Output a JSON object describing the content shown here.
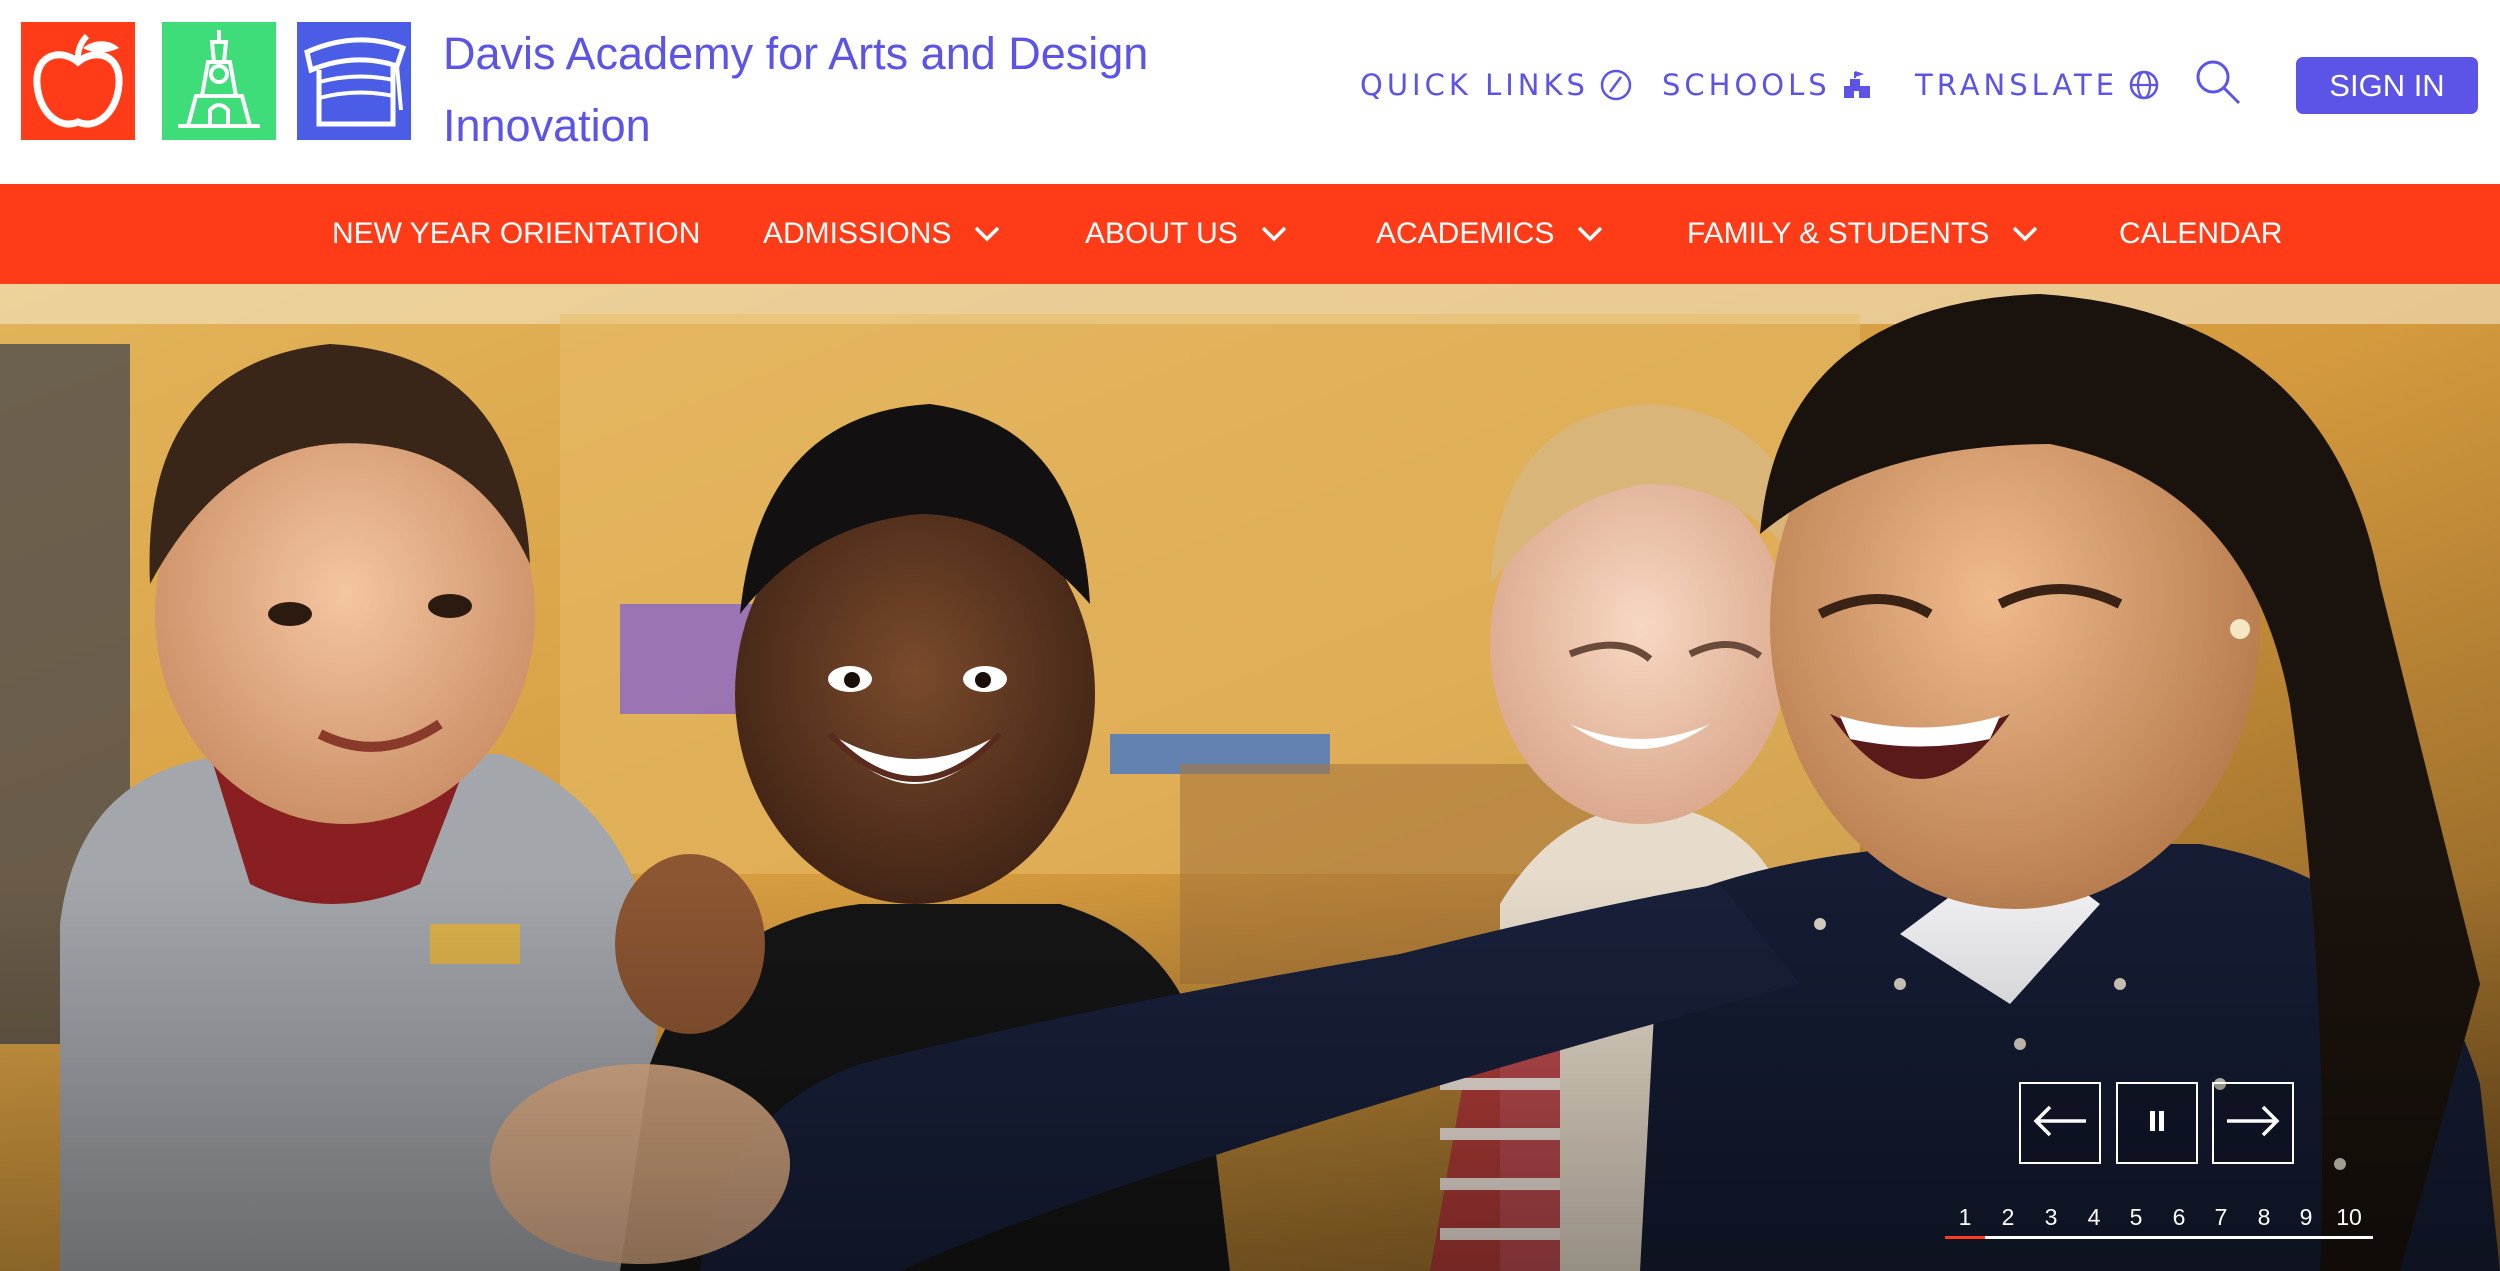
{
  "header": {
    "title": "Davis Academy for Arts and Design Innovation",
    "title_line1": "Davis Academy for Arts and Design",
    "title_line2": "Innovation",
    "logos": [
      {
        "name": "apple-logo",
        "color": "#ff3c17"
      },
      {
        "name": "tower-logo",
        "color": "#3fdc7a"
      },
      {
        "name": "cap-logo",
        "color": "#4b5ce6"
      }
    ],
    "utility": {
      "quick_links": "QUICK LINKS",
      "schools": "SCHOOLS",
      "translate": "TRANSLATE",
      "search_icon": "search-icon",
      "sign_in": "SIGN IN"
    }
  },
  "nav": {
    "items": [
      {
        "label": "NEW YEAR ORIENTATION",
        "dropdown": false
      },
      {
        "label": "ADMISSIONS",
        "dropdown": true
      },
      {
        "label": "ABOUT US",
        "dropdown": true
      },
      {
        "label": "ACADEMICS",
        "dropdown": true
      },
      {
        "label": "FAMILY & STUDENTS",
        "dropdown": true
      },
      {
        "label": "CALENDAR",
        "dropdown": false
      }
    ]
  },
  "hero": {
    "controls": {
      "prev_icon": "arrow-left-icon",
      "pause_icon": "pause-icon",
      "next_icon": "arrow-right-icon"
    },
    "slides": [
      "1",
      "2",
      "3",
      "4",
      "5",
      "6",
      "7",
      "8",
      "9",
      "10"
    ],
    "active_slide": 1
  },
  "colors": {
    "brand_purple": "#5b54e6",
    "nav_orange": "#ff3c17",
    "white": "#ffffff"
  }
}
